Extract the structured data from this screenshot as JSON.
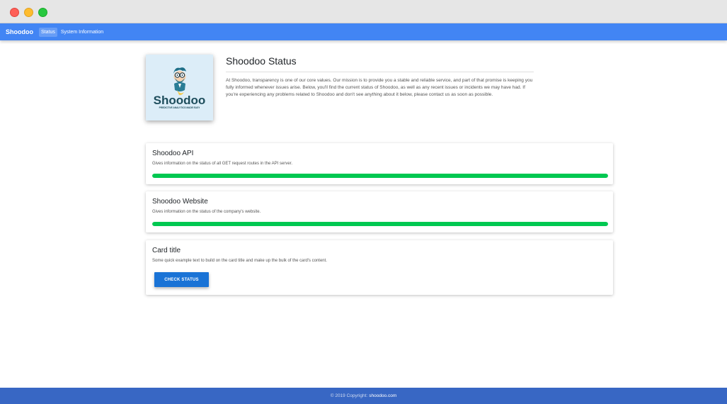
{
  "navbar": {
    "brand": "Shoodoo",
    "links": [
      "Status",
      "System Information"
    ]
  },
  "logo": {
    "wordmark": "Shoodoo",
    "tagline": "PREDICTIVE ANALYTICS MADE EASY"
  },
  "header": {
    "title": "Shoodoo Status",
    "intro": "At Shoodoo, transparency is one of our core values. Our mission is to provide you a stable and reliable service, and part of that promise is keeping you fully informed whenever issues arise. Below, you'll find the current status of Shoodoo, as well as any recent issues or incidents we may have had. If you're experiencing any problems related to Shoodoo and don't see anything about it below, please contact us as soon as possible."
  },
  "cards": [
    {
      "title": "Shoodoo API",
      "text": "Gives information on the status of all GET request routes in the API server.",
      "progress_percent": 100,
      "progress_color": "#00c851"
    },
    {
      "title": "Shoodoo Website",
      "text": "Gives information on the status of the company's website.",
      "progress_percent": 100,
      "progress_color": "#00c851"
    },
    {
      "title": "Card title",
      "text": "Some quick example text to build on the card title and make up the bulk of the card's content.",
      "button_label": "CHECK STATUS"
    }
  ],
  "footer": {
    "text": "© 2019 Copyright:",
    "link": "shoodoo.com"
  },
  "colors": {
    "navbar": "#4285f4",
    "footer": "#3867c4",
    "status_ok": "#00c851",
    "button": "#1a73d6"
  }
}
